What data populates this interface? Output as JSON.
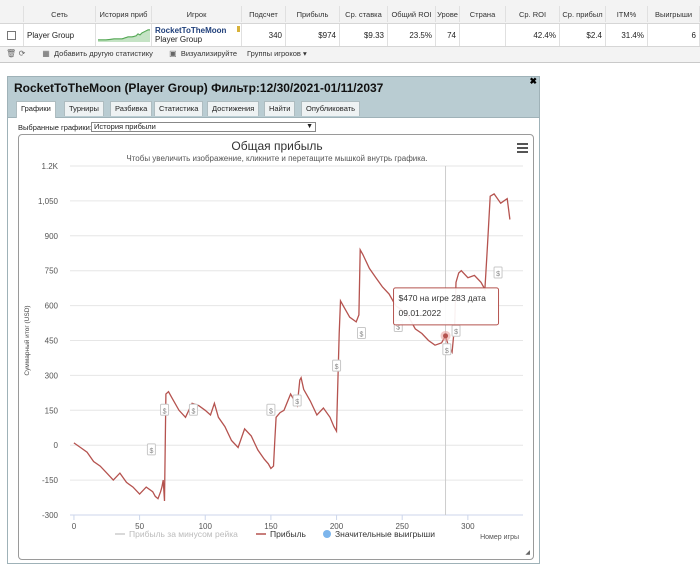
{
  "table": {
    "headers": [
      "Сеть",
      "История приб",
      "Игрок",
      "Подсчет",
      "Прибыль",
      "Ср. ставка",
      "Общий ROI",
      "Урове",
      "Страна",
      "Ср. ROI",
      "Ср. прибыл",
      "ITM%",
      "Выигрыши"
    ],
    "row": {
      "network": "Player Group",
      "player_name": "RocketToTheMoon",
      "player_group": "Player Group",
      "count": "340",
      "profit": "$974",
      "avg_stake": "$9.33",
      "total_roi": "23.5%",
      "level": "74",
      "country": "",
      "avg_roi": "42.4%",
      "avg_profit": "$2.4",
      "itm": "31.4%",
      "wins": "6"
    }
  },
  "toolbar": {
    "add_stat": "Добавить другую статистику",
    "visualize": "Визуализируйте",
    "groups": "Группы игроков ▾"
  },
  "panel": {
    "title": "RocketToTheMoon (Player Group) Фильтр:12/30/2021-01/11/2037",
    "tabs": [
      "Графики",
      "Турниры",
      "Разбивка",
      "Статистика",
      "Достижения",
      "Найти",
      "Опубликовать"
    ],
    "select_label": "Выбранные графики:",
    "select_value": "История прибыли"
  },
  "colors": {
    "profit_line": "#b5534f",
    "header_bg": "#b9ccd2",
    "marker": "#e8a6a4"
  },
  "chart_data": {
    "type": "line",
    "title": "Общая прибыль",
    "subtitle": "Чтобы увеличить изображение, кликните и перетащите мышкой внутрь графика.",
    "ylabel": "Суммарный итог (USD)",
    "xlabel": "Номер игры",
    "ylim": [
      -300,
      1200
    ],
    "xlim": [
      -3,
      342
    ],
    "y_ticks": [
      -300,
      -150,
      0,
      150,
      300,
      450,
      600,
      750,
      900,
      "1,050",
      "1.2K"
    ],
    "y_tick_values": [
      -300,
      -150,
      0,
      150,
      300,
      450,
      600,
      750,
      900,
      1050,
      1200
    ],
    "x_ticks": [
      0,
      50,
      100,
      150,
      200,
      250,
      300
    ],
    "legend": [
      "Прибыль за минусом рейка",
      "Прибыль",
      "Значительные выигрыши"
    ],
    "tooltip": {
      "line1": "$470 на игре 283 дата",
      "line2": "09.01.2022"
    },
    "crosshair_x": 283,
    "series": [
      {
        "name": "Прибыль",
        "x": [
          0,
          5,
          10,
          15,
          20,
          25,
          30,
          35,
          40,
          45,
          50,
          55,
          60,
          62,
          64,
          66,
          67,
          68,
          69,
          70,
          72,
          75,
          80,
          85,
          90,
          95,
          100,
          104,
          107,
          110,
          115,
          120,
          125,
          130,
          135,
          140,
          145,
          148,
          150,
          152,
          153,
          154,
          157,
          160,
          165,
          170,
          172,
          173,
          175,
          180,
          185,
          190,
          195,
          198,
          200,
          202,
          203,
          205,
          210,
          215,
          217,
          218,
          220,
          225,
          230,
          235,
          240,
          245,
          250,
          255,
          260,
          265,
          270,
          275,
          280,
          283,
          285,
          288,
          290,
          291,
          293,
          295,
          300,
          305,
          310,
          312,
          313,
          315,
          317,
          320,
          325,
          330,
          332
        ],
        "y": [
          10,
          -10,
          -30,
          -70,
          -90,
          -120,
          -150,
          -120,
          -160,
          -180,
          -210,
          -180,
          -200,
          -220,
          -230,
          -200,
          -180,
          -150,
          -240,
          220,
          230,
          200,
          150,
          120,
          180,
          170,
          150,
          130,
          180,
          120,
          80,
          20,
          -10,
          70,
          40,
          -20,
          -60,
          -80,
          -100,
          -90,
          20,
          120,
          140,
          150,
          220,
          170,
          280,
          290,
          240,
          190,
          130,
          160,
          120,
          80,
          60,
          480,
          620,
          600,
          550,
          530,
          560,
          840,
          820,
          760,
          720,
          680,
          650,
          600,
          580,
          550,
          500,
          480,
          450,
          430,
          440,
          470,
          430,
          400,
          520,
          700,
          740,
          750,
          720,
          730,
          700,
          680,
          670,
          860,
          1070,
          1080,
          1040,
          1060,
          970
        ]
      }
    ],
    "markers": {
      "label": "$",
      "x": [
        59,
        69,
        91,
        150,
        170,
        200,
        219,
        247,
        284,
        291,
        323
      ],
      "y": [
        -20,
        150,
        150,
        150,
        190,
        340,
        480,
        510,
        410,
        490,
        740
      ]
    }
  }
}
